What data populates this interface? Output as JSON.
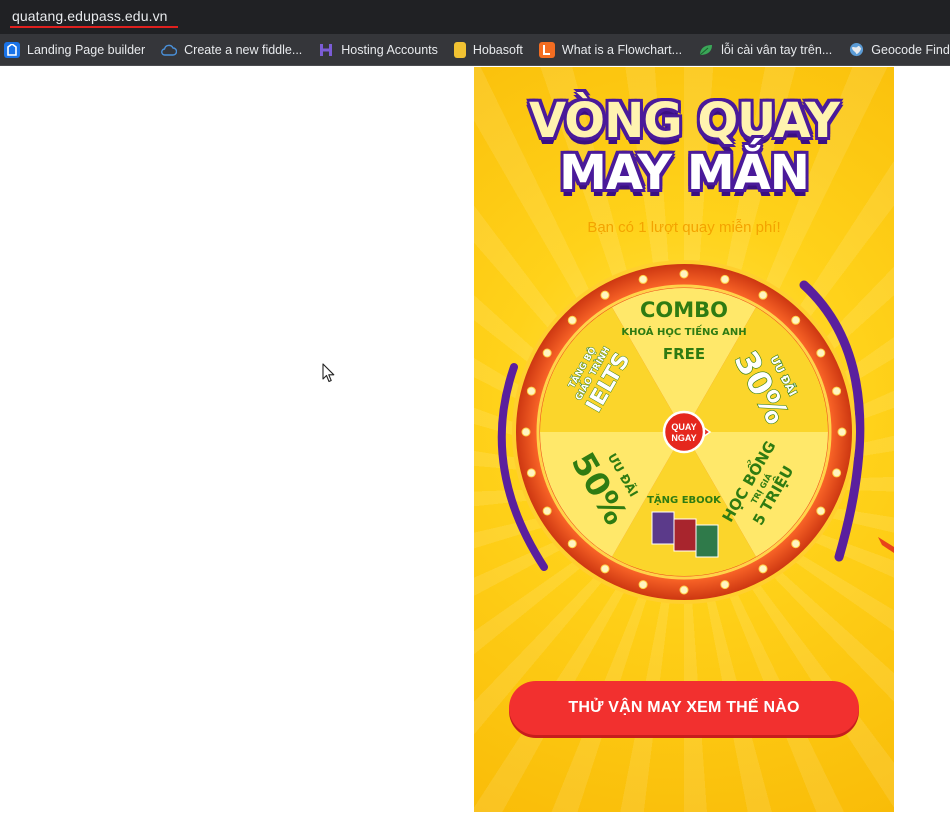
{
  "browser": {
    "url": "quatang.edupass.edu.vn",
    "bookmarks": [
      {
        "label": "Landing Page builder",
        "icon": "ladipage-icon",
        "color": "#1a73e8"
      },
      {
        "label": "Create a new fiddle...",
        "icon": "cloud-icon",
        "color": "#4a90d9"
      },
      {
        "label": "Hosting Accounts",
        "icon": "hosting-icon",
        "color": "#6b4fbb"
      },
      {
        "label": "Hobasoft",
        "icon": "folder-icon",
        "color": "#f1c232"
      },
      {
        "label": "What is a Flowchart...",
        "icon": "lucid-icon",
        "color": "#f36d21"
      },
      {
        "label": "lỗi cài vân tay trên...",
        "icon": "leaf-icon",
        "color": "#3aa757"
      },
      {
        "label": "Geocode Finder",
        "icon": "globe-icon",
        "color": "#5b9bd5"
      }
    ]
  },
  "game": {
    "title_line1": "VÒNG QUAY",
    "title_line2": "MAY MẮN",
    "spins_text": "Bạn có  1  lượt quay miễn phí!",
    "center_button": [
      "QUAY",
      "NGAY"
    ],
    "cta_label": "THỬ VẬN MAY XEM THẾ NÀO",
    "colors": {
      "segment_dark": "#fbd52b",
      "segment_light": "#ffe86a",
      "rim": "#e84a1c",
      "text_green": "#2f7b12",
      "cta": "#f2302f",
      "title_outline": "#4a1a9a"
    },
    "segments": [
      {
        "lines": [
          "COMBO",
          "KHOÁ HỌC TIẾNG ANH",
          "FREE"
        ]
      },
      {
        "lines": [
          "ƯU ĐÃI",
          "30%"
        ]
      },
      {
        "lines": [
          "HỌC BỔNG",
          "TRỊ GIÁ",
          "5 TRIỆU"
        ]
      },
      {
        "lines": [
          "TẶNG EBOOK"
        ]
      },
      {
        "lines": [
          "ƯU ĐÃI",
          "50%"
        ]
      },
      {
        "lines": [
          "TẶNG BỘ",
          "GIÁO TRÌNH",
          "IELTS"
        ]
      }
    ]
  }
}
